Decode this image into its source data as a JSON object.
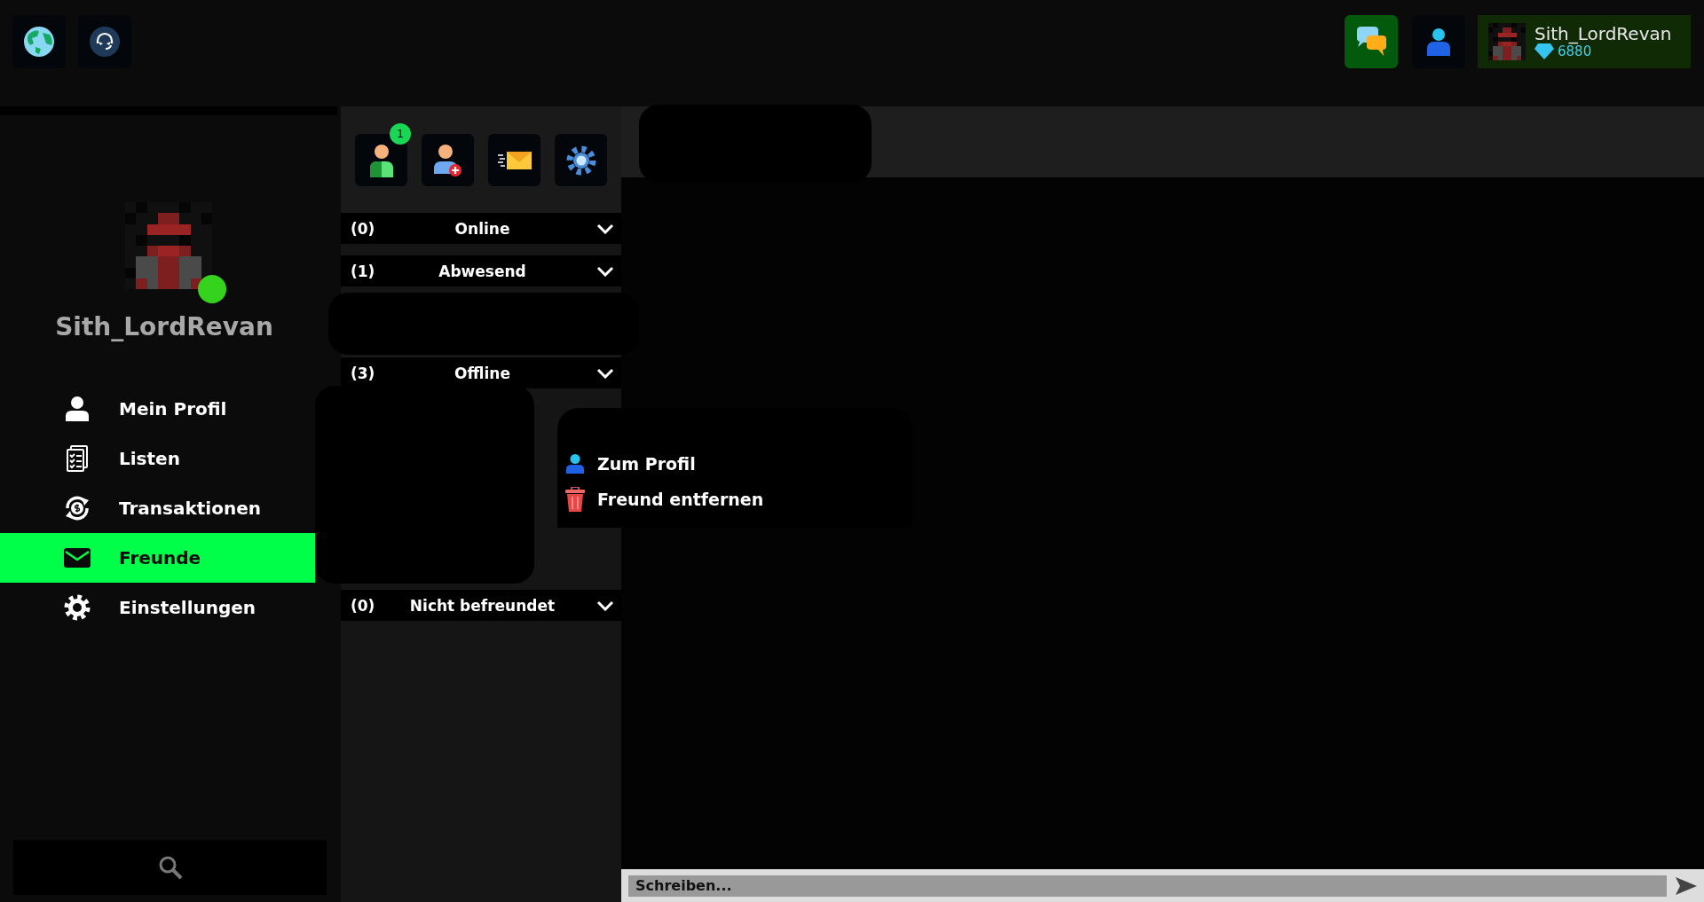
{
  "top_bar": {
    "user": {
      "name": "Sith_LordRevan",
      "gems": "6880"
    }
  },
  "sidebar": {
    "profile": {
      "name": "Sith_LordRevan",
      "online": true
    },
    "menu": [
      {
        "label": "Mein Profil",
        "kind": "person",
        "selected": false
      },
      {
        "label": "Listen",
        "kind": "lists",
        "selected": false
      },
      {
        "label": "Transaktionen",
        "kind": "transactions",
        "selected": false
      },
      {
        "label": "Freunde",
        "kind": "mail",
        "selected": true
      },
      {
        "label": "Einstellungen",
        "kind": "gear",
        "selected": false
      }
    ]
  },
  "friends": {
    "toolbar": [
      {
        "kind": "friends",
        "badge": "1"
      },
      {
        "kind": "add-friend"
      },
      {
        "kind": "mail"
      },
      {
        "kind": "gear"
      }
    ],
    "groups": [
      {
        "count": "(0)",
        "label": "Online"
      },
      {
        "count": "(1)",
        "label": "Abwesend"
      },
      {
        "count": "(3)",
        "label": "Offline"
      },
      {
        "count": "(0)",
        "label": "Nicht befreundet"
      }
    ]
  },
  "context_menu": [
    {
      "label": "Zum Profil",
      "kind": "profile"
    },
    {
      "label": "Freund entfernen",
      "kind": "remove"
    }
  ],
  "chat": {
    "placeholder": "Schreiben..."
  }
}
